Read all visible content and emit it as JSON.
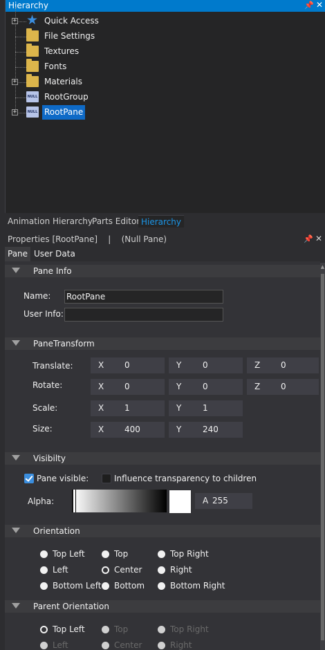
{
  "hierarchy": {
    "title": "Hierarchy",
    "pin_glyph": "📌",
    "close_glyph": "✕",
    "items": [
      {
        "label": "Quick Access",
        "icon": "star-icon",
        "expander": "+"
      },
      {
        "label": "File Settings",
        "icon": "folder-icon"
      },
      {
        "label": "Textures",
        "icon": "folder-icon"
      },
      {
        "label": "Fonts",
        "icon": "folder-icon"
      },
      {
        "label": "Materials",
        "icon": "folder-icon",
        "expander": "+"
      },
      {
        "label": "RootGroup",
        "icon": "null-icon",
        "icon_text": "NULL"
      },
      {
        "label": "RootPane",
        "icon": "null-icon",
        "icon_text": "NULL",
        "expander": "+",
        "selected": true
      }
    ]
  },
  "tabs": {
    "animation_hierarchy": "Animation Hierarchy",
    "parts_editor": "Parts Editor",
    "hierarchy": "Hierarchy"
  },
  "properties": {
    "title": "Properties [RootPane]    |    (Null Pane)",
    "pin_glyph": "📌",
    "close_glyph": "✕",
    "tab_pane": "Pane",
    "tab_user_data": "User Data",
    "pane_info": {
      "header": "Pane Info",
      "name_label": "Name:",
      "name_value": "RootPane",
      "user_info_label": "User Info:",
      "user_info_value": ""
    },
    "pane_transform": {
      "header": "PaneTransform",
      "translate_label": "Translate:",
      "rotate_label": "Rotate:",
      "scale_label": "Scale:",
      "size_label": "Size:",
      "axis_x": "X",
      "axis_y": "Y",
      "axis_z": "Z",
      "translate": {
        "x": "0",
        "y": "0",
        "z": "0"
      },
      "rotate": {
        "x": "0",
        "y": "0",
        "z": "0"
      },
      "scale": {
        "x": "1",
        "y": "1"
      },
      "size": {
        "x": "400",
        "y": "240"
      }
    },
    "visibility": {
      "header": "Visibilty",
      "pane_visible_label": "Pane visible:",
      "pane_visible_checked": true,
      "influence_label": "Influence transparency to children",
      "influence_checked": false,
      "alpha_label": "Alpha:",
      "alpha_axis": "A",
      "alpha_value": "255"
    },
    "orientation": {
      "header": "Orientation",
      "top_left": "Top Left",
      "top": "Top",
      "top_right": "Top Right",
      "left": "Left",
      "center": "Center",
      "right": "Right",
      "bottom_left": "Bottom Left",
      "bottom": "Bottom",
      "bottom_right": "Bottom Right",
      "selected": "Center"
    },
    "parent_orientation": {
      "header": "Parent Orientation",
      "top_left": "Top Left",
      "top": "Top",
      "top_right": "Top Right",
      "left": "Left",
      "center": "Center",
      "right": "Right",
      "selected": "Top Left"
    }
  }
}
